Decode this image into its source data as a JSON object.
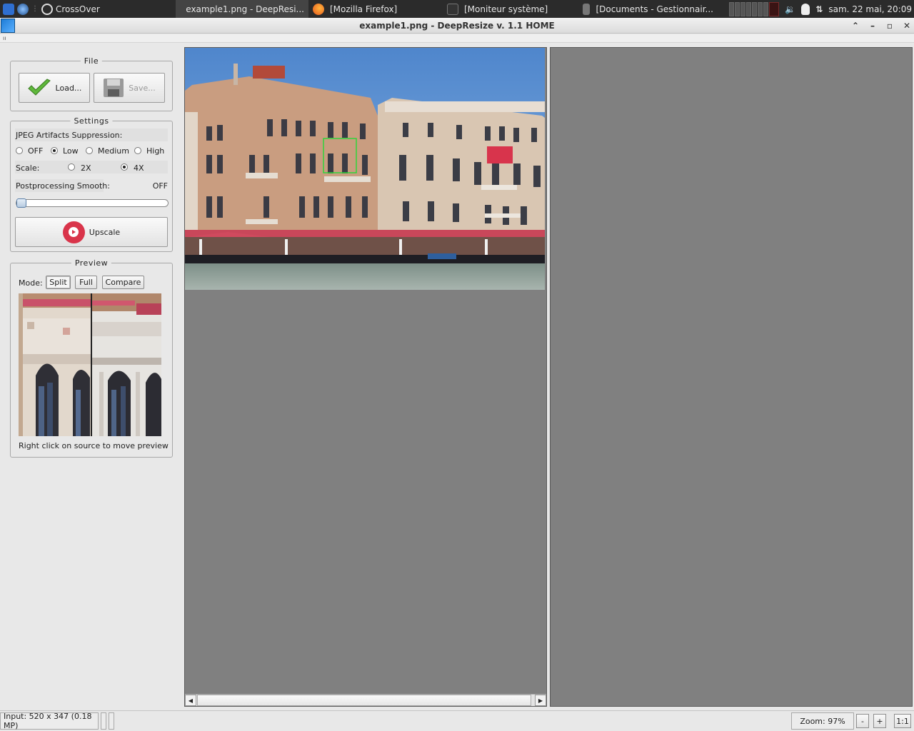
{
  "taskbar": {
    "launchers": [
      "CrossOver"
    ],
    "tasks": [
      {
        "label": "example1.png - DeepResi...",
        "active": true
      },
      {
        "label": "[Mozilla Firefox]",
        "active": false
      },
      {
        "label": "[Moniteur système]",
        "active": false
      },
      {
        "label": "[Documents - Gestionnair...",
        "active": false
      }
    ],
    "clock": "sam. 22 mai, 20:09"
  },
  "window": {
    "title": "example1.png - DeepResize v. 1.1 HOME",
    "menu_glyph": "ıı"
  },
  "file_group": {
    "title": "File",
    "load_label": "Load...",
    "save_label": "Save..."
  },
  "settings_group": {
    "title": "Settings",
    "jpeg_label": "JPEG Artifacts Suppression:",
    "jpeg_options": [
      "OFF",
      "Low",
      "Medium",
      "High"
    ],
    "jpeg_selected": "Low",
    "scale_label": "Scale:",
    "scale_options": [
      "2X",
      "4X"
    ],
    "scale_selected": "4X",
    "smooth_label": "Postprocessing Smooth:",
    "smooth_value": "OFF",
    "smooth_level": 0,
    "upscale_label": "Upscale"
  },
  "preview_group": {
    "title": "Preview",
    "mode_label": "Mode:",
    "modes": [
      "Split",
      "Full",
      "Compare"
    ],
    "mode_selected": "Split",
    "hint": "Right click on source to move preview"
  },
  "statusbar": {
    "input_info": "Input: 520 x 347 (0.18 MP)",
    "zoom": "Zoom: 97%",
    "zoom_out": "-",
    "zoom_in": "+",
    "zoom_reset": "1:1"
  },
  "colors": {
    "accent_red": "#d9344a",
    "pane_gray": "#808080",
    "sky": "#5b8fd0"
  }
}
